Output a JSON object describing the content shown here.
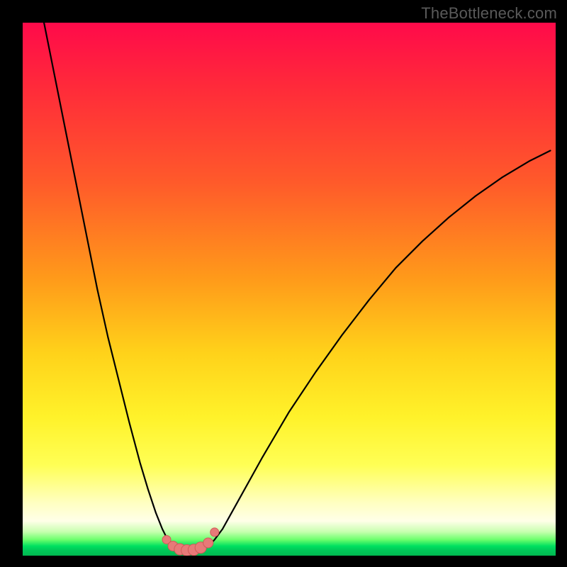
{
  "watermark": {
    "text": "TheBottleneck.com"
  },
  "colors": {
    "frame": "#000000",
    "curve": "#000000",
    "marker_fill": "#e77a78",
    "marker_stroke": "#d05a58",
    "gradient_top": "#ff0a4a",
    "gradient_bottom": "#00b850"
  },
  "chart_data": {
    "type": "line",
    "title": "",
    "xlabel": "",
    "ylabel": "",
    "xlim": [
      0,
      100
    ],
    "ylim": [
      0,
      100
    ],
    "axes_visible": false,
    "note": "Values estimated from pixel positions; axes have no labels.",
    "series": [
      {
        "name": "left-branch",
        "x": [
          4,
          6,
          8,
          10,
          12,
          14,
          16,
          18,
          20,
          22,
          23.5,
          25,
          26.2,
          27.2,
          28,
          28.6
        ],
        "y": [
          100,
          90,
          80,
          70,
          60,
          50,
          41,
          33,
          25,
          17.5,
          12.5,
          8,
          5,
          3,
          2,
          1.5
        ]
      },
      {
        "name": "trough",
        "x": [
          28.6,
          29.4,
          30.4,
          31.6,
          32.8,
          34.0,
          35.0
        ],
        "y": [
          1.5,
          1.1,
          0.95,
          0.9,
          1.0,
          1.3,
          1.9
        ]
      },
      {
        "name": "right-branch",
        "x": [
          35.0,
          36,
          37.5,
          40,
          45,
          50,
          55,
          60,
          65,
          70,
          75,
          80,
          85,
          90,
          95,
          99
        ],
        "y": [
          1.9,
          3.0,
          5.0,
          9.5,
          18.5,
          27,
          34.5,
          41.5,
          48,
          54,
          59,
          63.5,
          67.5,
          71,
          74,
          76
        ]
      }
    ],
    "markers": {
      "name": "salmon-dots",
      "x": [
        27.0,
        28.2,
        29.5,
        30.8,
        32.1,
        33.4,
        34.8,
        36.0
      ],
      "y": [
        3.0,
        1.8,
        1.2,
        1.0,
        1.1,
        1.5,
        2.4,
        4.4
      ],
      "r": [
        6,
        7,
        8,
        8,
        8,
        8,
        7,
        6
      ]
    }
  }
}
